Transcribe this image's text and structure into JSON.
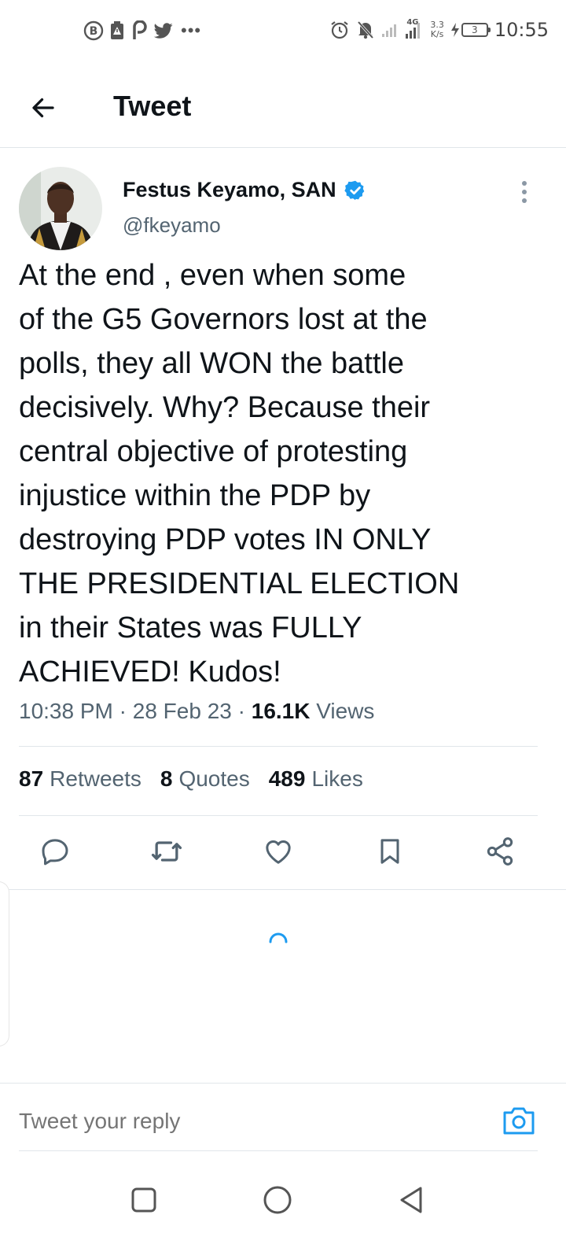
{
  "status_bar": {
    "time": "10:55",
    "network": "4G",
    "speed_value": "3.3",
    "speed_unit": "K/s",
    "battery": "3",
    "overflow": "•••"
  },
  "header": {
    "title": "Tweet"
  },
  "author": {
    "name": "Festus Keyamo, SAN",
    "handle": "@fkeyamo",
    "verified": true
  },
  "tweet": {
    "text": "At the end , even when some\nof the G5 Governors lost at the\npolls, they all WON the battle\ndecisively. Why? Because their\ncentral objective of protesting\ninjustice within the PDP by\ndestroying PDP votes IN ONLY\nTHE PRESIDENTIAL ELECTION\nin their States was FULLY\nACHIEVED! Kudos!",
    "time": "10:38 PM",
    "separator": " · ",
    "date": "28 Feb 23",
    "views_count": "16.1K",
    "views_label": "Views"
  },
  "stats": {
    "retweets_count": "87",
    "retweets_label": "Retweets",
    "quotes_count": "8",
    "quotes_label": "Quotes",
    "likes_count": "489",
    "likes_label": "Likes"
  },
  "reply": {
    "placeholder": "Tweet your reply"
  },
  "colors": {
    "accent": "#1d9bf0",
    "text": "#0f1419",
    "muted": "#536471",
    "divider": "#e1e6ea"
  },
  "icons": [
    "back-arrow-icon",
    "verified-badge-icon",
    "more-vertical-icon",
    "reply-icon",
    "retweet-icon",
    "like-icon",
    "bookmark-icon",
    "share-icon",
    "loading-spinner-icon",
    "camera-icon",
    "nav-recents-icon",
    "nav-home-icon",
    "nav-back-icon"
  ]
}
